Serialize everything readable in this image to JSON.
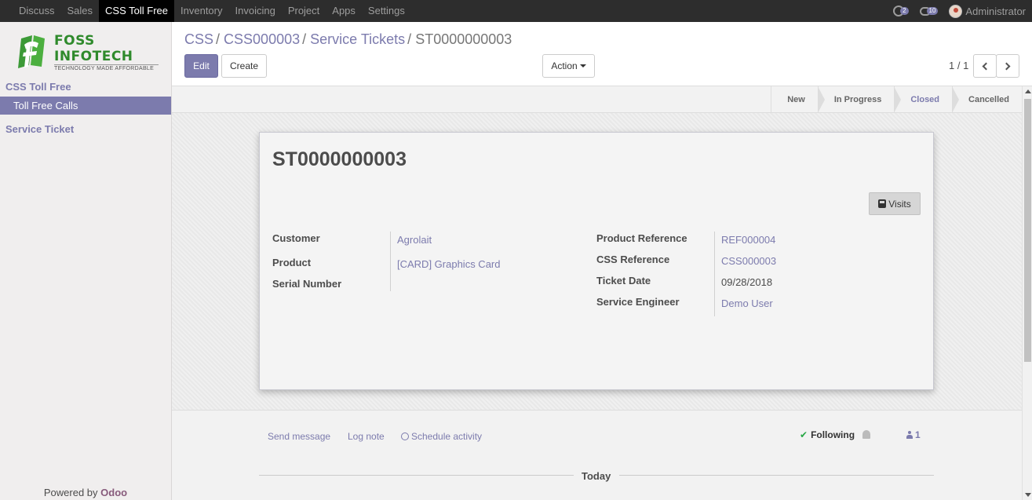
{
  "topbar": {
    "menu": [
      {
        "label": "Discuss",
        "active": false
      },
      {
        "label": "Sales",
        "active": false
      },
      {
        "label": "CSS Toll Free",
        "active": true
      },
      {
        "label": "Inventory",
        "active": false
      },
      {
        "label": "Invoicing",
        "active": false
      },
      {
        "label": "Project",
        "active": false
      },
      {
        "label": "Apps",
        "active": false
      },
      {
        "label": "Settings",
        "active": false
      }
    ],
    "activity_count": "2",
    "message_count": "10",
    "user_name": "Administrator"
  },
  "sidebar": {
    "logo_name": "FOSS INFOTECH",
    "logo_tagline": "TECHNOLOGY MADE AFFORDABLE",
    "section1": "CSS Toll Free",
    "active_item": "Toll Free Calls",
    "section2": "Service Ticket",
    "powered_prefix": "Powered by",
    "powered_brand": "Odoo"
  },
  "breadcrumb": {
    "items": [
      "CSS",
      "CSS000003",
      "Service Tickets"
    ],
    "current": "ST0000000003"
  },
  "toolbar": {
    "edit_label": "Edit",
    "create_label": "Create",
    "action_label": "Action",
    "pager": "1 / 1"
  },
  "stages": [
    {
      "label": "New",
      "current": false
    },
    {
      "label": "In Progress",
      "current": false
    },
    {
      "label": "Closed",
      "current": true
    },
    {
      "label": "Cancelled",
      "current": false
    }
  ],
  "record": {
    "title": "ST0000000003",
    "visits_label": "Visits",
    "left_fields": [
      {
        "label": "Customer",
        "value": "Agrolait",
        "link": true
      },
      {
        "label": "Product",
        "value": "[CARD] Graphics Card",
        "link": true
      },
      {
        "label": "Serial Number",
        "value": "",
        "link": false
      }
    ],
    "right_fields": [
      {
        "label": "Product Reference",
        "value": "REF000004",
        "link": true
      },
      {
        "label": "CSS Reference",
        "value": "CSS000003",
        "link": true
      },
      {
        "label": "Ticket Date",
        "value": "09/28/2018",
        "link": false
      },
      {
        "label": "Service Engineer",
        "value": "Demo User",
        "link": true
      }
    ]
  },
  "chatter": {
    "send_message": "Send message",
    "log_note": "Log note",
    "schedule_activity": "Schedule activity",
    "following": "Following",
    "followers_count": "1",
    "today": "Today"
  },
  "colors": {
    "brand": "#7c7bad",
    "navbar": "#2d2d2d",
    "logo_green": "#3c9a37"
  }
}
